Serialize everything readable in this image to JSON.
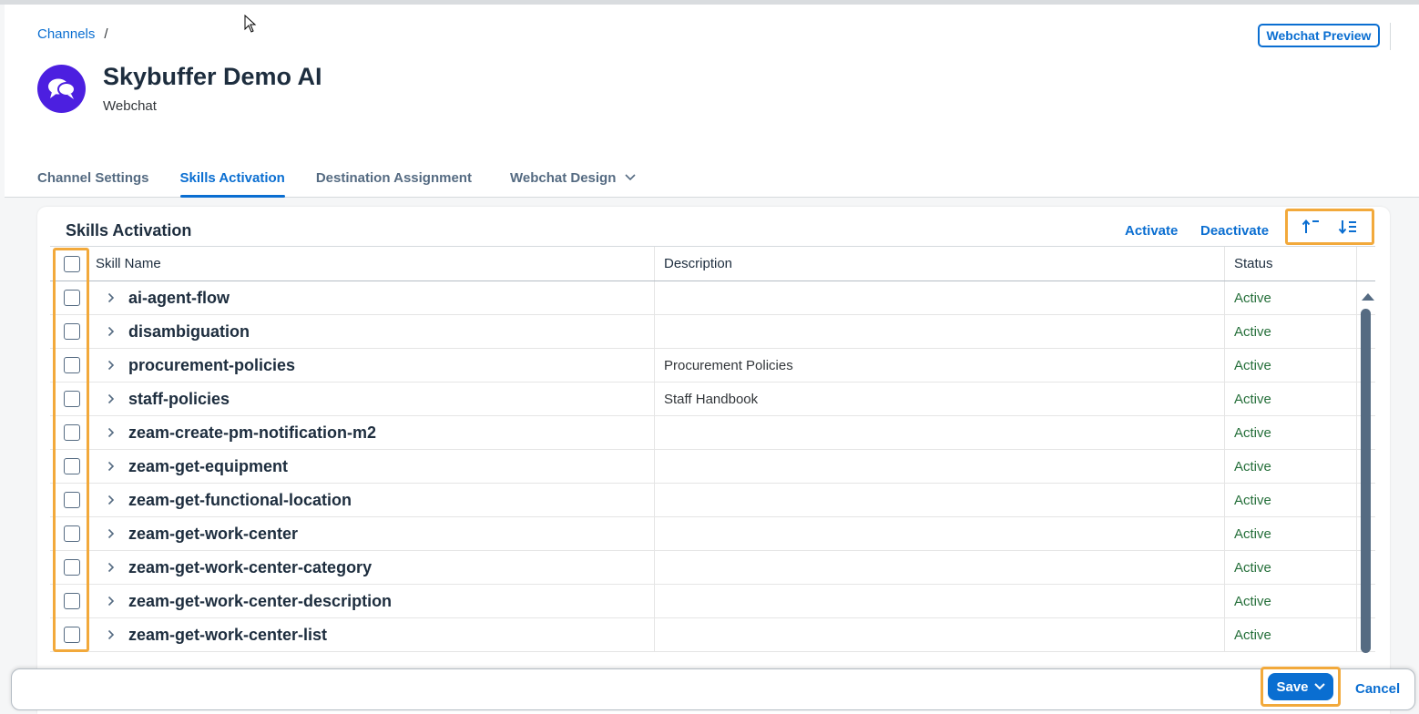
{
  "breadcrumb": {
    "link": "Channels",
    "separator": "/"
  },
  "header": {
    "title": "Skybuffer Demo AI",
    "subtitle": "Webchat",
    "preview_button": "Webchat Preview"
  },
  "tabs": [
    {
      "label": "Channel Settings",
      "active": false
    },
    {
      "label": "Skills Activation",
      "active": true
    },
    {
      "label": "Destination Assignment",
      "active": false
    },
    {
      "label": "Webchat Design",
      "active": false
    }
  ],
  "panel": {
    "title": "Skills Activation",
    "activate": "Activate",
    "deactivate": "Deactivate",
    "sort_asc_icon": "sort-ascending-icon",
    "sort_desc_icon": "sort-descending-icon"
  },
  "table": {
    "columns": {
      "name": "Skill Name",
      "description": "Description",
      "status": "Status"
    },
    "rows": [
      {
        "name": "ai-agent-flow",
        "description": "",
        "status": "Active"
      },
      {
        "name": "disambiguation",
        "description": "",
        "status": "Active"
      },
      {
        "name": "procurement-policies",
        "description": "Procurement Policies",
        "status": "Active"
      },
      {
        "name": "staff-policies",
        "description": "Staff Handbook",
        "status": "Active"
      },
      {
        "name": "zeam-create-pm-notification-m2",
        "description": "",
        "status": "Active"
      },
      {
        "name": "zeam-get-equipment",
        "description": "",
        "status": "Active"
      },
      {
        "name": "zeam-get-functional-location",
        "description": "",
        "status": "Active"
      },
      {
        "name": "zeam-get-work-center",
        "description": "",
        "status": "Active"
      },
      {
        "name": "zeam-get-work-center-category",
        "description": "",
        "status": "Active"
      },
      {
        "name": "zeam-get-work-center-description",
        "description": "",
        "status": "Active"
      },
      {
        "name": "zeam-get-work-center-list",
        "description": "",
        "status": "Active"
      }
    ]
  },
  "footer": {
    "save": "Save",
    "cancel": "Cancel"
  },
  "colors": {
    "accent": "#0a6ed1",
    "highlight": "#f2a93b",
    "active_status": "#256f3a",
    "avatar": "#4c1fe0"
  }
}
